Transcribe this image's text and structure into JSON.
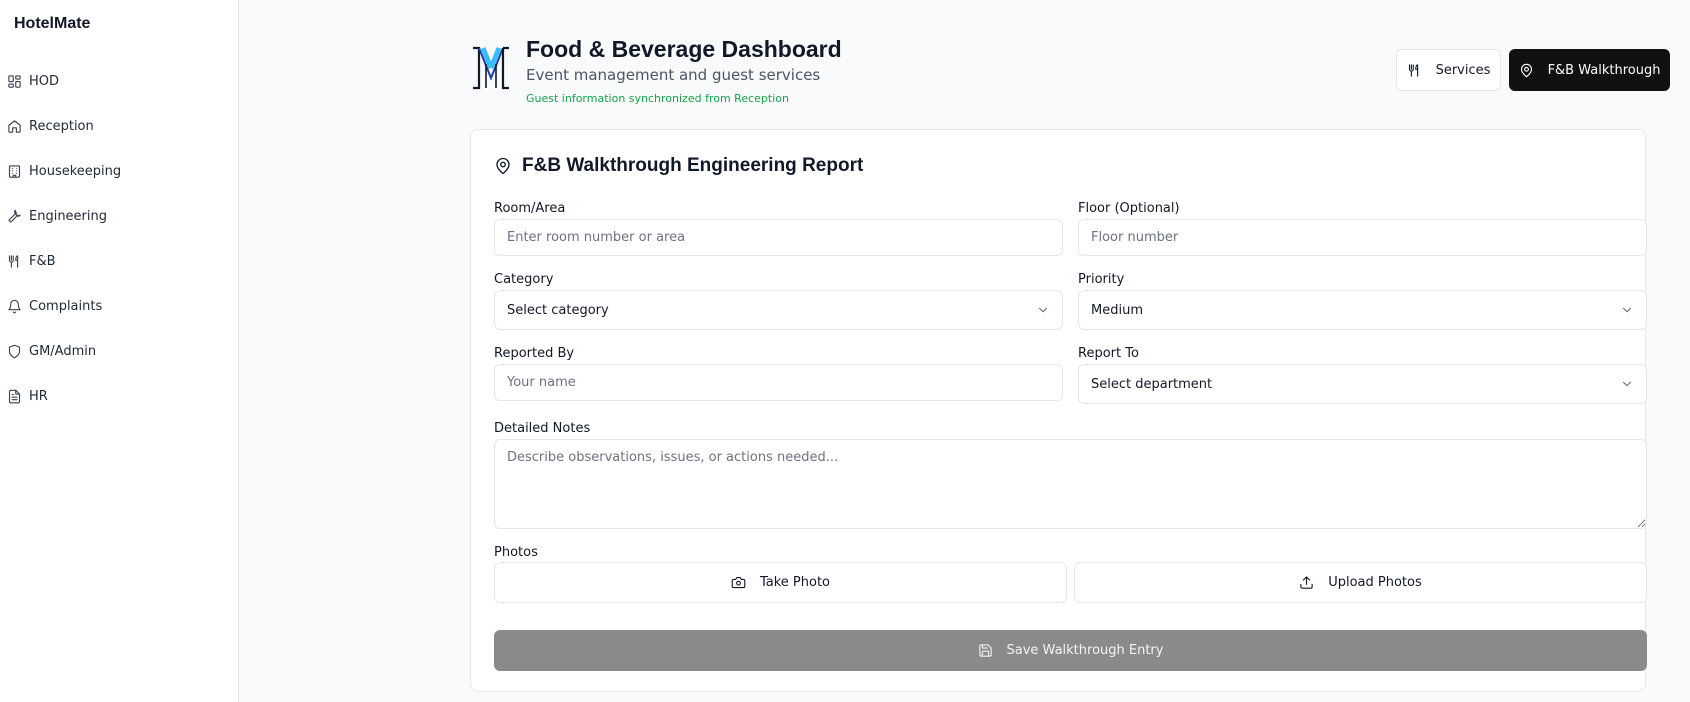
{
  "sidebar": {
    "brand": "HotelMate",
    "items": [
      {
        "label": "HOD",
        "icon": "grid-icon"
      },
      {
        "label": "Reception",
        "icon": "home-icon"
      },
      {
        "label": "Housekeeping",
        "icon": "building-icon"
      },
      {
        "label": "Engineering",
        "icon": "wrench-icon"
      },
      {
        "label": "F&B",
        "icon": "utensils-icon"
      },
      {
        "label": "Complaints",
        "icon": "bell-icon"
      },
      {
        "label": "GM/Admin",
        "icon": "shield-icon"
      },
      {
        "label": "HR",
        "icon": "document-icon"
      }
    ]
  },
  "header": {
    "logo_icon": "hotel-monogram-logo",
    "title": "Food & Beverage Dashboard",
    "subtitle": "Event management and guest services",
    "sync_note": "Guest information synchronized from Reception",
    "services_label": "Services",
    "walkthrough_label": "F&B Walkthrough"
  },
  "form": {
    "title": "F&B Walkthrough Engineering Report",
    "room": {
      "label": "Room/Area",
      "placeholder": "Enter room number or area"
    },
    "floor": {
      "label": "Floor (Optional)",
      "placeholder": "Floor number"
    },
    "category": {
      "label": "Category",
      "value": "Select category"
    },
    "priority": {
      "label": "Priority",
      "value": "Medium"
    },
    "reported_by": {
      "label": "Reported By",
      "placeholder": "Your name"
    },
    "report_to": {
      "label": "Report To",
      "value": "Select department"
    },
    "notes": {
      "label": "Detailed Notes",
      "placeholder": "Describe observations, issues, or actions needed..."
    },
    "photos": {
      "label": "Photos",
      "take_label": "Take Photo",
      "upload_label": "Upload Photos"
    },
    "save_label": "Save Walkthrough Entry"
  },
  "colors": {
    "primary": "#111111",
    "sync_green": "#16a34a",
    "disabled_button": "#8a8a8a"
  }
}
